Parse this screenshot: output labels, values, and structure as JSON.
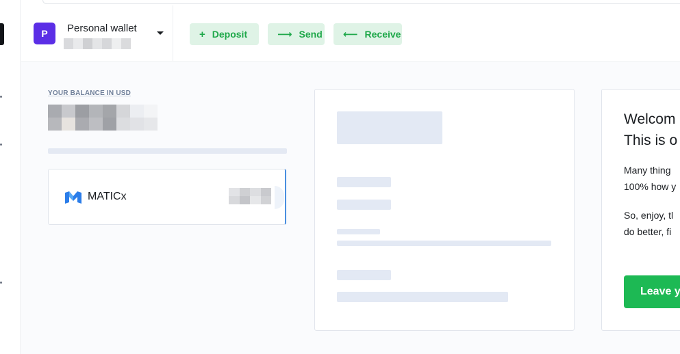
{
  "wallet": {
    "avatar_letter": "P",
    "name": "Personal wallet"
  },
  "actions": {
    "deposit": {
      "icon": "+",
      "label": "Deposit"
    },
    "send": {
      "icon": "⟶",
      "label": "Send"
    },
    "receive": {
      "icon": "⟵",
      "label": "Receive"
    }
  },
  "balance": {
    "label": "YOUR BALANCE IN USD"
  },
  "token": {
    "name": "MATICx",
    "logo_color": "#2b7de9"
  },
  "welcome": {
    "title_line1": "Welcom",
    "title_line2": "This is o",
    "para1_line1": "Many thing",
    "para1_line2": "100% how y",
    "para2_line1": "So, enjoy, tl",
    "para2_line2": "do better, fi",
    "button_label": "Leave y"
  },
  "colors": {
    "accent_green": "#1db954",
    "avatar_purple": "#5b2ee6",
    "action_bg": "#dff3e6"
  }
}
